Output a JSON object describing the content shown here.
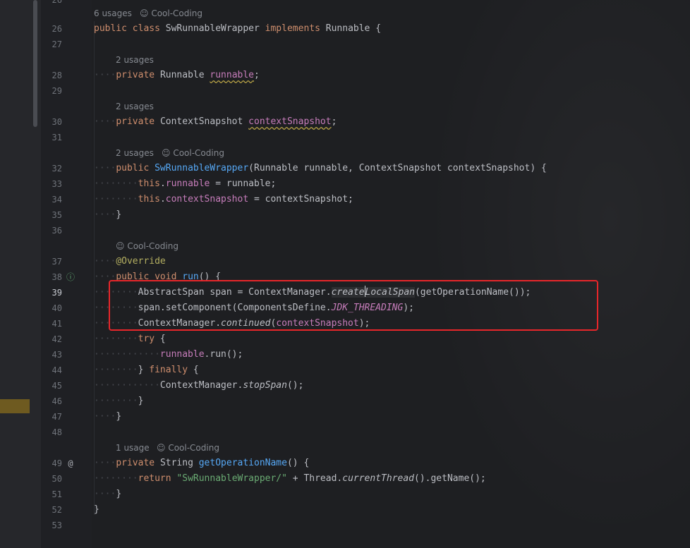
{
  "gutter": {
    "line_numbers": [
      "26",
      "27",
      "28",
      "29",
      "30",
      "31",
      "32",
      "33",
      "34",
      "35",
      "36",
      "37",
      "38",
      "39",
      "40",
      "41",
      "42",
      "43",
      "44",
      "45",
      "46",
      "47",
      "48",
      "49",
      "50",
      "51",
      "52",
      "53"
    ],
    "top_line_number": "26",
    "icons": {
      "impl": "implements-method-gutter-icon",
      "override": "overrides-method-gutter-icon"
    }
  },
  "hints": {
    "class_usages": "6 usages",
    "author": "Cool-Coding",
    "runnable_usages": "2 usages",
    "snapshot_usages": "2 usages",
    "ctor_usages": "2 usages",
    "getop_usages": "1 usage"
  },
  "code": {
    "l26": {
      "k1": "public",
      "k2": "class",
      "name": "SwRunnableWrapper",
      "k3": "implements",
      "iface": "Runnable",
      "brace": "{"
    },
    "l28": {
      "k": "private",
      "type": "Runnable",
      "field": "runnable",
      "semi": ";"
    },
    "l30": {
      "k": "private",
      "type": "ContextSnapshot",
      "field": "contextSnapshot",
      "semi": ";"
    },
    "l32": {
      "k": "public",
      "fn": "SwRunnableWrapper",
      "params": "(Runnable runnable, ContextSnapshot contextSnapshot) {"
    },
    "l33": {
      "k": "this",
      "field": "runnable",
      "rest": " = runnable;"
    },
    "l34": {
      "k": "this",
      "field": "contextSnapshot",
      "rest": " = contextSnapshot;"
    },
    "l35": "}",
    "l37": "@Override",
    "l38": {
      "k1": "public",
      "k2": "void",
      "fn": "run",
      "rest": "() {"
    },
    "l39": {
      "a": "AbstractSpan span = ContextManager.",
      "m1": "create",
      "m2": "LocalSpan",
      "b": "(getOperationName());"
    },
    "l40": {
      "a": "span.setComponent(ComponentsDefine.",
      "c": "JDK_THREADING",
      "b": ");"
    },
    "l41": {
      "a": "ContextManager.",
      "m": "continued",
      "p1": "(",
      "field": "contextSnapshot",
      "p2": ");"
    },
    "l42": {
      "k": "try",
      "rest": " {"
    },
    "l43": {
      "field": "runnable",
      "rest": ".run();"
    },
    "l44": {
      "a": "} ",
      "k": "finally",
      "b": " {"
    },
    "l45": {
      "a": "ContextManager.",
      "m": "stopSpan",
      "b": "();"
    },
    "l46": "}",
    "l47": "}",
    "l49": {
      "k": "private",
      "type": "String",
      "fn": "getOperationName",
      "rest": "() {"
    },
    "l50": {
      "k": "return",
      "str": "\"SwRunnableWrapper/\"",
      "a": " + Thread.",
      "m": "currentThread",
      "b": "().getName();"
    },
    "l51": "}",
    "l52": "}"
  },
  "colors": {
    "keyword": "#cf8e6d",
    "function": "#56a8f5",
    "field": "#c77dbb",
    "string": "#6aab73",
    "annotation": "#b3ae60",
    "highlight_box": "#e8262a"
  }
}
